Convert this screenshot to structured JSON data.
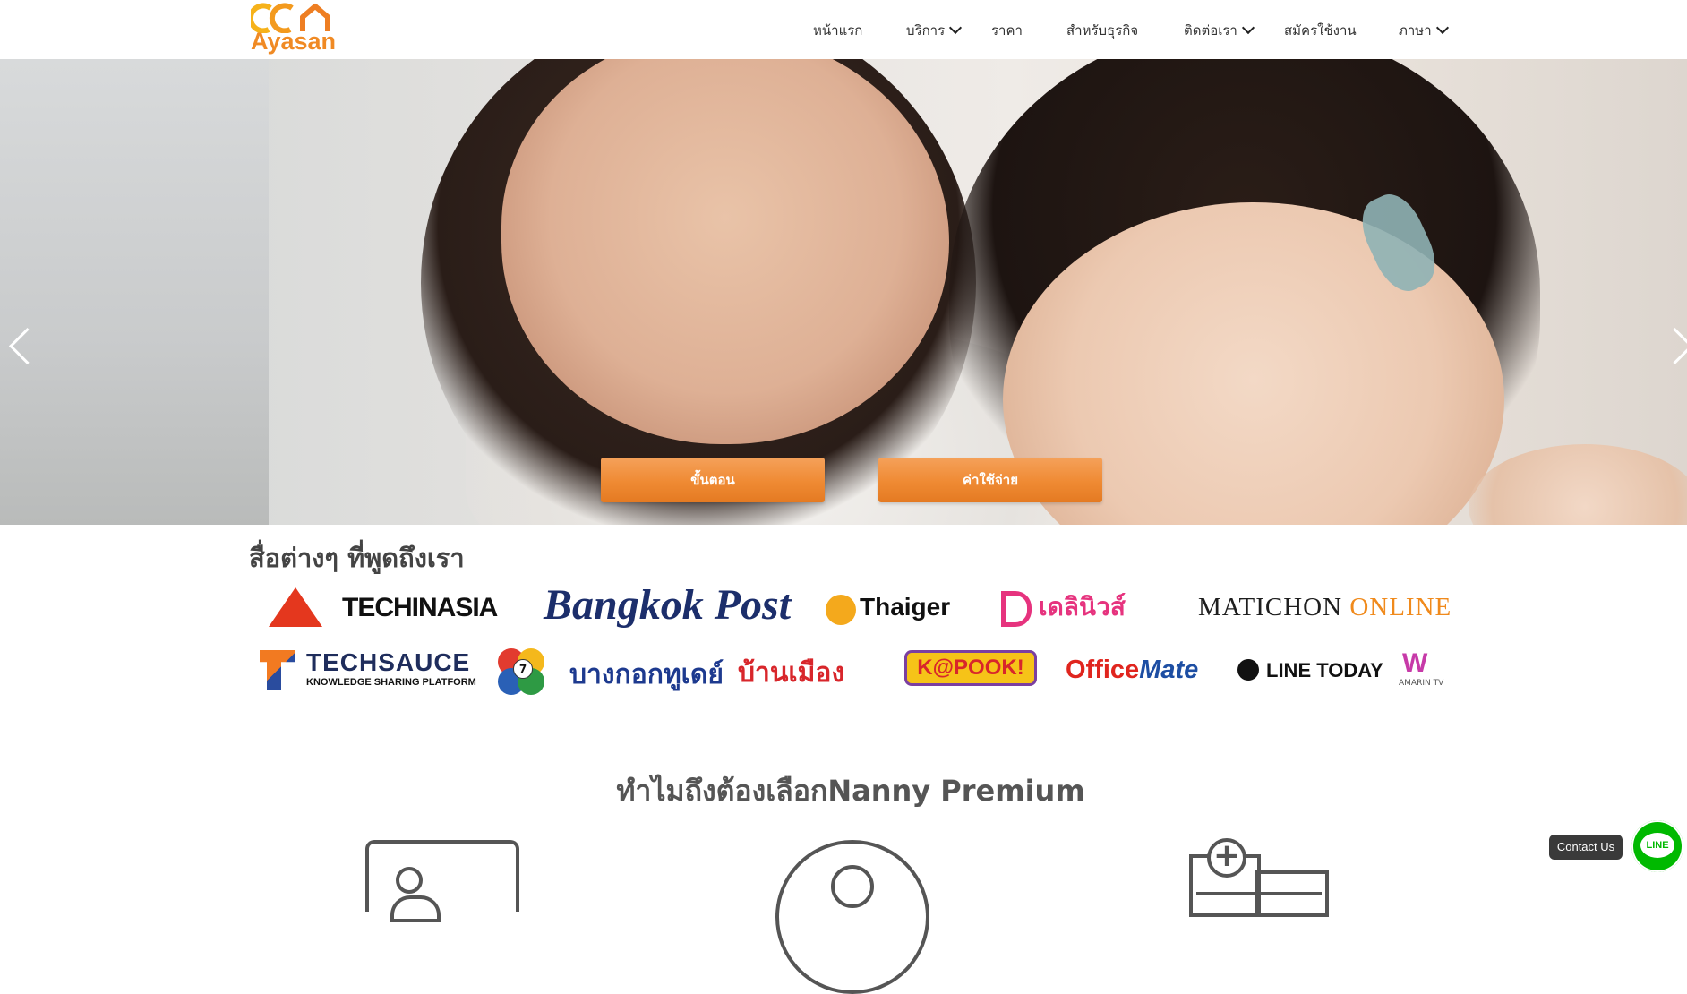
{
  "brand": {
    "logo_text": "Ayasan"
  },
  "nav": {
    "items": [
      {
        "label": "หน้าแรก",
        "has_dropdown": false
      },
      {
        "label": "บริการ",
        "has_dropdown": true
      },
      {
        "label": "ราคา",
        "has_dropdown": false
      },
      {
        "label": "สำหรับธุรกิจ",
        "has_dropdown": false
      },
      {
        "label": "ติดต่อเรา",
        "has_dropdown": true
      },
      {
        "label": "สมัครใช้งาน",
        "has_dropdown": false
      },
      {
        "label": "ภาษา",
        "has_dropdown": true
      }
    ]
  },
  "hero": {
    "buttons": [
      {
        "label": "ขั้นตอน"
      },
      {
        "label": "ค่าใช้จ่าย"
      }
    ]
  },
  "media": {
    "title": "สื่อต่างๆ ที่พูดถึงเรา",
    "logos": {
      "techinasia": "TECHINASIA",
      "bangkokpost": "Bangkok Post",
      "thaiger": "Thaiger",
      "dailynews": "เดลินิวส์",
      "matichon_main": "MATICHON",
      "matichon_sub": "ONLINE",
      "techsauce": "TECHSAUCE",
      "techsauce_sub": "KNOWLEDGE SHARING PLATFORM",
      "ch7_number": "7",
      "bangkoktoday": "บางกอกทูเดย์",
      "banmuang": "บ้านเมือง",
      "kapook": "K@POOK!",
      "officemate_1": "Office",
      "officemate_2": "Mate",
      "linetoday": "LINE TODAY",
      "amarin_sub": "AMARIN TV"
    }
  },
  "why": {
    "title": "ทำไมถึงต้องเลือกNanny Premium"
  },
  "contact": {
    "label": "Contact Us",
    "line_label": "LINE"
  },
  "colors": {
    "accent": "#f08a24",
    "line_green": "#00b900"
  }
}
